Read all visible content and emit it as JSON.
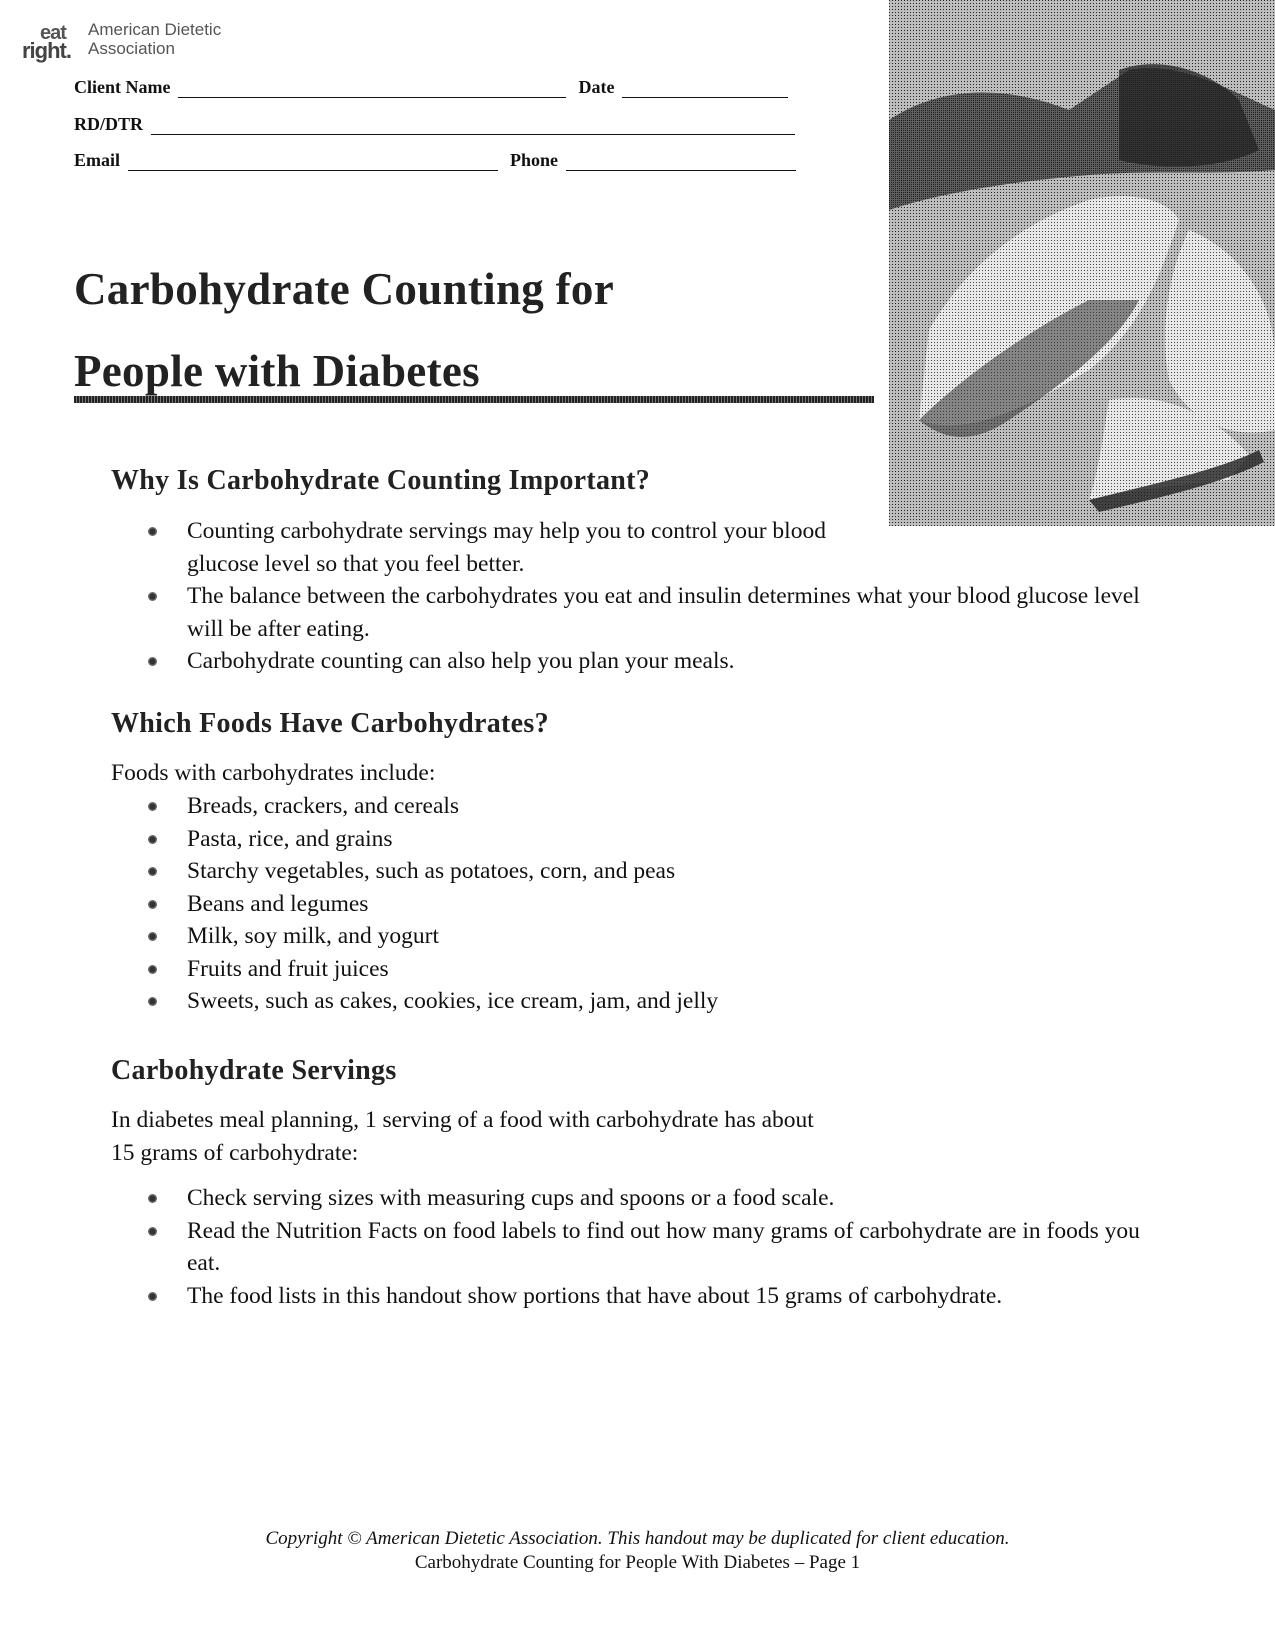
{
  "logo": {
    "mark_top": "eat",
    "mark_bottom": "right.",
    "org_line1": "American Dietetic",
    "org_line2": "Association"
  },
  "form": {
    "client_name_label": "Client Name",
    "client_name_value": "",
    "date_label": "Date",
    "date_value": "",
    "rd_dtr_label": "RD/DTR",
    "rd_dtr_value": "",
    "email_label": "Email",
    "email_value": "",
    "phone_label": "Phone",
    "phone_value": ""
  },
  "photo": {
    "description": "grayscale halftone photo of salmon fillet with lemon wedge"
  },
  "title": {
    "line1": "Carbohydrate Counting for",
    "line2": "People with Diabetes"
  },
  "sections": [
    {
      "heading": "Why Is Carbohydrate Counting Important?",
      "bullets": [
        "Counting carbohydrate servings may help you to control your blood glucose level so that you feel better.",
        "The balance between the carbohydrates you eat and insulin determines what your blood glucose level will be after eating.",
        "Carbohydrate counting can also help you plan your meals."
      ]
    },
    {
      "heading": "Which Foods Have Carbohydrates?",
      "intro": "Foods with carbohydrates include:",
      "bullets": [
        "Breads, crackers, and cereals",
        "Pasta, rice, and grains",
        "Starchy vegetables, such as potatoes, corn, and peas",
        "Beans and legumes",
        "Milk, soy milk, and yogurt",
        "Fruits and fruit juices",
        "Sweets, such as cakes, cookies, ice cream, jam, and jelly"
      ]
    },
    {
      "heading": "Carbohydrate Servings",
      "intro_line1": "In diabetes meal planning, 1 serving of a food with carbohydrate has about",
      "intro_line2": "15 grams of carbohydrate:",
      "bullets": [
        "Check serving sizes with measuring cups and spoons or a food scale.",
        "Read the Nutrition Facts on food labels to find out how many grams of carbohydrate are in foods you eat.",
        "The food lists in this handout show portions that have about 15 grams of carbohydrate."
      ]
    }
  ],
  "footer": {
    "copyright": "Copyright © American Dietetic Association. This handout may be duplicated for client education.",
    "page_line": "Carbohydrate Counting for People With Diabetes – Page 1"
  }
}
